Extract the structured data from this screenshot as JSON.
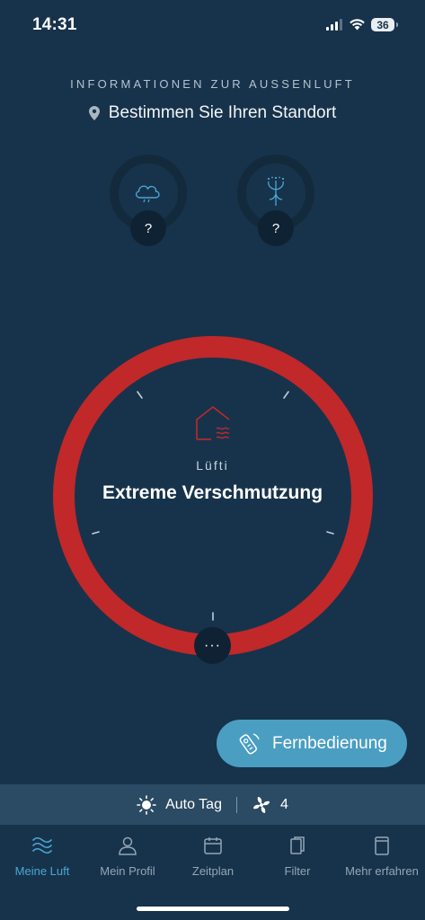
{
  "status_bar": {
    "time": "14:31",
    "battery": "36"
  },
  "outside_air": {
    "title": "INFORMATIONEN ZUR AUSSENLUFT",
    "location_text": "Bestimmen Sie Ihren Standort",
    "location_icon": "location-pin-icon",
    "indicators": [
      {
        "icon": "weather-cloud-icon",
        "value": "?"
      },
      {
        "icon": "pollen-flower-icon",
        "value": "?"
      }
    ]
  },
  "gauge": {
    "icon": "house-air-icon",
    "label": "Lüfti",
    "status": "Extreme Verschmutzung",
    "ring_color": "#c0282a",
    "more_label": "···"
  },
  "remote_button": {
    "label": "Fernbedienung",
    "icon": "remote-control-icon"
  },
  "mode_bar": {
    "mode_icon": "sun-icon",
    "mode_label": "Auto Tag",
    "fan_icon": "fan-icon",
    "fan_level": "4"
  },
  "tabs": [
    {
      "label": "Meine Luft",
      "icon": "waves-icon",
      "active": true
    },
    {
      "label": "Mein Profil",
      "icon": "person-icon",
      "active": false
    },
    {
      "label": "Zeitplan",
      "icon": "calendar-icon",
      "active": false
    },
    {
      "label": "Filter",
      "icon": "filter-icon",
      "active": false
    },
    {
      "label": "Mehr erfahren",
      "icon": "book-icon",
      "active": false
    }
  ],
  "colors": {
    "background": "#17334b",
    "accent": "#4aa6d6",
    "danger": "#c0282a",
    "button": "#4a9ec2"
  }
}
